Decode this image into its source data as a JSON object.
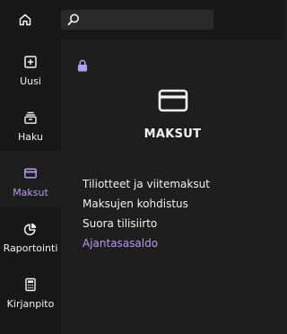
{
  "search": {
    "value": "",
    "placeholder": ""
  },
  "sidebar": {
    "items": [
      {
        "label": "Uusi",
        "icon": "plus-square-icon"
      },
      {
        "label": "Haku",
        "icon": "archive-icon"
      },
      {
        "label": "Maksut",
        "icon": "credit-card-icon",
        "active": true
      },
      {
        "label": "Raportointi",
        "icon": "pie-chart-icon"
      },
      {
        "label": "Kirjanpito",
        "icon": "calculator-icon"
      }
    ]
  },
  "main": {
    "title": "MAKSUT",
    "links": [
      {
        "label": "Tiliotteet ja viitemaksut"
      },
      {
        "label": "Maksujen kohdistus"
      },
      {
        "label": "Suora tilisiirto"
      },
      {
        "label": "Ajantasasaldo",
        "current": true
      }
    ]
  },
  "colors": {
    "accent": "#b79cf5",
    "sidebar_bg": "#181818",
    "main_bg": "#1e1e1e",
    "text": "#f2f2f2"
  }
}
